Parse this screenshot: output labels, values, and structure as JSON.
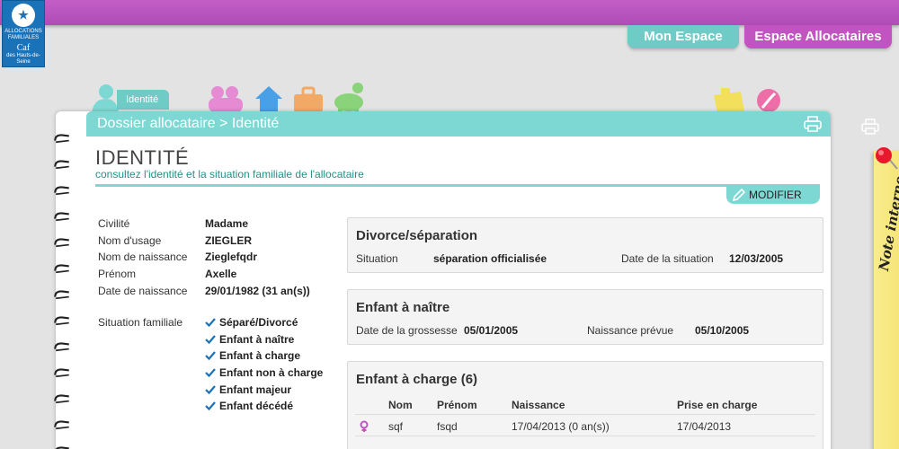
{
  "logo": {
    "line1": "ALLOCATIONS",
    "line2": "FAMILIALES",
    "caf": "Caf",
    "region": "des Hauts-de-Seine"
  },
  "top_tabs": {
    "mon_espace": "Mon Espace",
    "espace_allocataires": "Espace Allocataires"
  },
  "section_tab": "Identité",
  "breadcrumb": "Dossier allocataire > Identité",
  "title": "IDENTITÉ",
  "subtitle": "consultez l'identité et la situation familiale de l'allocataire",
  "modify_label": "MODIFIER",
  "identity": [
    {
      "label": "Civilité",
      "value": "Madame"
    },
    {
      "label": "Nom d'usage",
      "value": "ZIEGLER"
    },
    {
      "label": "Nom de naissance",
      "value": "Zieglefqdr"
    },
    {
      "label": "Prénom",
      "value": "Axelle"
    },
    {
      "label": "Date de naissance",
      "value": "29/01/1982 (31 an(s))"
    }
  ],
  "situation": {
    "label": "Situation familiale",
    "items": [
      "Séparé/Divorcé",
      "Enfant à naître",
      "Enfant à charge",
      "Enfant non à charge",
      "Enfant majeur",
      "Enfant décédé"
    ]
  },
  "divorce_panel": {
    "title": "Divorce/séparation",
    "situation_label": "Situation",
    "situation_value": "séparation officialisée",
    "date_label": "Date de la situation",
    "date_value": "12/03/2005"
  },
  "unborn_panel": {
    "title": "Enfant à naître",
    "pregnancy_label": "Date de la grossesse",
    "pregnancy_value": "05/01/2005",
    "birth_label": "Naissance prévue",
    "birth_value": "05/10/2005"
  },
  "children_panel": {
    "title": "Enfant à charge (6)",
    "headers": [
      "Nom",
      "Prénom",
      "Naissance",
      "Prise en charge"
    ],
    "rows": [
      {
        "nom": "sqf",
        "prenom": "fsqd",
        "naissance": "17/04/2013 (0 an(s))",
        "prise": "17/04/2013"
      }
    ]
  },
  "sticky_note": "Note interne",
  "colors": {
    "topbar": "#b04cb6",
    "teal": "#7dd8d3",
    "magenta": "#c254c2",
    "sticky": "#f5e370"
  }
}
